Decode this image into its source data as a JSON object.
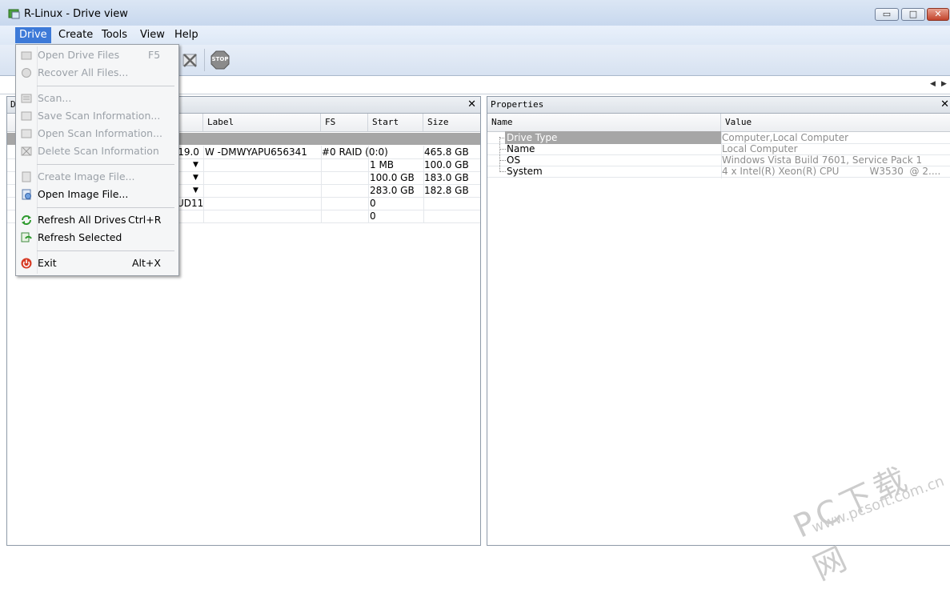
{
  "window": {
    "title": "R-Linux - Drive view",
    "minimize": "▭",
    "maximize": "□",
    "close": "✕"
  },
  "menubar": {
    "items": [
      "Drive",
      "Create",
      "Tools",
      "View",
      "Help"
    ]
  },
  "toolbar": {
    "stop_label": "STOP"
  },
  "drive_menu": {
    "items": [
      {
        "label": "Open Drive Files",
        "shortcut": "F5",
        "enabled": false,
        "icon": "open-drive-icon"
      },
      {
        "label": "Recover All Files...",
        "shortcut": "",
        "enabled": false,
        "icon": "recover-icon"
      },
      {
        "label": "Scan...",
        "shortcut": "",
        "enabled": false,
        "icon": "scan-icon"
      },
      {
        "label": "Save Scan Information...",
        "shortcut": "",
        "enabled": false,
        "icon": "save-scan-icon"
      },
      {
        "label": "Open Scan Information...",
        "shortcut": "",
        "enabled": false,
        "icon": "open-scan-icon"
      },
      {
        "label": "Delete Scan Information",
        "shortcut": "",
        "enabled": false,
        "icon": "delete-scan-icon"
      },
      {
        "label": "Create Image File...",
        "shortcut": "",
        "enabled": false,
        "icon": "create-image-icon"
      },
      {
        "label": "Open Image File...",
        "shortcut": "",
        "enabled": true,
        "icon": "open-image-icon"
      },
      {
        "label": "Refresh All Drives",
        "shortcut": "Ctrl+R",
        "enabled": true,
        "icon": "refresh-icon"
      },
      {
        "label": "Refresh Selected",
        "shortcut": "",
        "enabled": true,
        "icon": "refresh-selected-icon"
      },
      {
        "label": "Exit",
        "shortcut": "Alt+X",
        "enabled": true,
        "icon": "exit-icon"
      }
    ]
  },
  "drive_pane": {
    "title_visible": "D",
    "columns": [
      "Label",
      "FS",
      "Start",
      "Size"
    ],
    "rows": [
      {
        "device": "A19.0",
        "label": "W -DMWYAPU656341",
        "fs": "#0  RAID (0:0)",
        "start": "",
        "size": "465.8 GB",
        "dropdown": false
      },
      {
        "device": "",
        "label": "",
        "fs": "",
        "start": "1 MB",
        "size": "100.0 GB",
        "dropdown": true
      },
      {
        "device": "",
        "label": "",
        "fs": "",
        "start": "100.0 GB",
        "size": "183.0 GB",
        "dropdown": true
      },
      {
        "device": "",
        "label": "",
        "fs": "",
        "start": "283.0 GB",
        "size": "182.8 GB",
        "dropdown": true
      },
      {
        "device": "UD11",
        "label": "",
        "fs": "",
        "start": "0",
        "size": "",
        "dropdown": false
      },
      {
        "device": "",
        "label": "",
        "fs": "",
        "start": "0",
        "size": "",
        "dropdown": false
      }
    ]
  },
  "properties_pane": {
    "title": "Properties",
    "columns": [
      "Name",
      "Value"
    ],
    "rows": [
      {
        "name": "Drive Type",
        "value": "Computer,Local Computer"
      },
      {
        "name": "Name",
        "value": "Local Computer"
      },
      {
        "name": "OS",
        "value": "Windows Vista Build 7601, Service Pack 1"
      },
      {
        "name": "System",
        "value": "4 x Intel(R) Xeon(R) CPU          W3530  @ 2...."
      }
    ]
  },
  "watermark": {
    "line1": "PC下载网",
    "line2": "www.pcsoft.com.cn"
  }
}
